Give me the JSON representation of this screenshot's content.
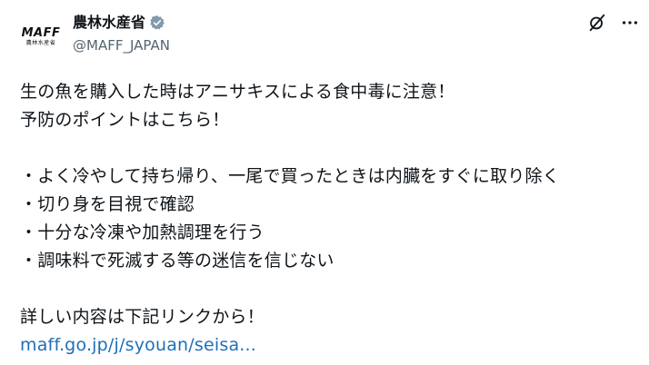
{
  "account": {
    "display_name": "農林水産省",
    "handle": "@MAFF_JAPAN",
    "logo_text": "MAFF",
    "logo_subtext": "農林水産省"
  },
  "icons": {
    "verified": "verified-badge-icon",
    "grok": "grok-icon",
    "more": "more-options-icon"
  },
  "tweet": {
    "line1": "生の魚を購入した時はアニサキスによる食中毒に注意！",
    "line2": "予防のポイントはこちら！",
    "bullet1": "・よく冷やして持ち帰り、一尾で買ったときは内臓をすぐに取り除く",
    "bullet2": "・切り身を目視で確認",
    "bullet3": "・十分な冷凍や加熱調理を行う",
    "bullet4": "・調味料で死滅する等の迷信を信じない",
    "line3": "詳しい内容は下記リンクから！",
    "link": "maff.go.jp/j/syouan/seisa..."
  },
  "colors": {
    "text": "#0f1419",
    "secondary": "#536471",
    "link": "#1d6fb8",
    "verified": "#829aab"
  }
}
